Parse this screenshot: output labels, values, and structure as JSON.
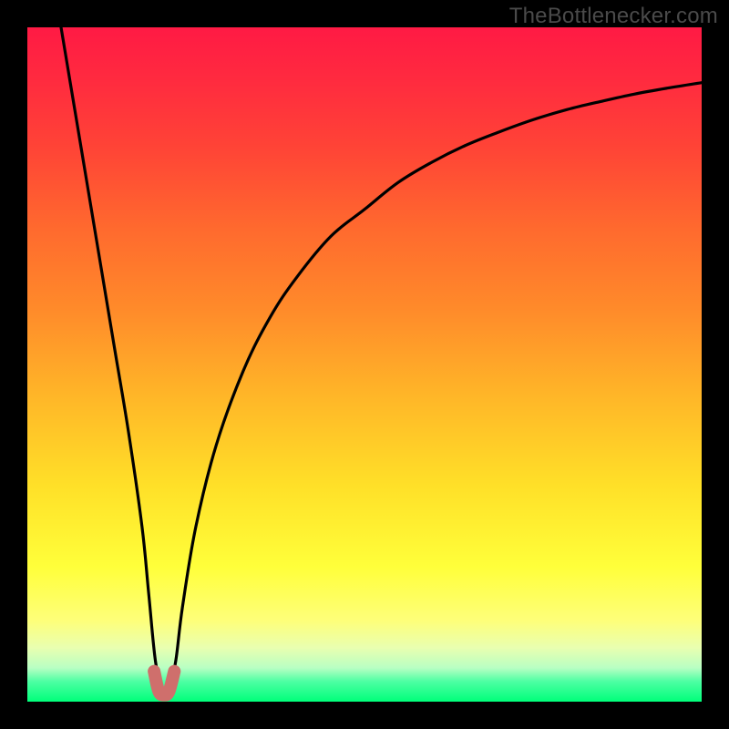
{
  "watermark": "TheBottlenecker.com",
  "chart_data": {
    "type": "line",
    "title": "",
    "xlabel": "",
    "ylabel": "",
    "xlim": [
      0,
      100
    ],
    "ylim": [
      0,
      100
    ],
    "annotations": [],
    "notes": "Gradient background from red (top, high bottleneck) to green (bottom, 0%). A black V-shaped curve dips from the top-left edge to ~0 at x≈20 then rises asymptotically toward the top-right. A short salmon segment marks the minimum.",
    "series": [
      {
        "name": "bottleneck-curve",
        "color": "#000000",
        "x": [
          5,
          7,
          9,
          11,
          13,
          15,
          17,
          18,
          19,
          20,
          21,
          22,
          23,
          25,
          28,
          32,
          36,
          40,
          45,
          50,
          55,
          60,
          65,
          70,
          75,
          80,
          85,
          90,
          95,
          100
        ],
        "y": [
          100,
          88,
          76,
          64,
          52,
          40,
          26,
          16,
          6,
          2,
          2,
          6,
          14,
          26,
          38,
          49,
          57,
          63,
          69,
          73,
          77,
          80,
          82.5,
          84.5,
          86.3,
          87.8,
          89,
          90.1,
          91,
          91.8
        ]
      },
      {
        "name": "optimal-marker",
        "color": "#cf6f6c",
        "x": [
          18.8,
          19.5,
          20.3,
          21.0,
          21.8
        ],
        "y": [
          4.5,
          1.5,
          1.0,
          1.5,
          4.5
        ]
      }
    ],
    "background_gradient": {
      "top": "#ff1a44",
      "mid": "#ffe028",
      "bottom": "#00ff7a"
    }
  }
}
